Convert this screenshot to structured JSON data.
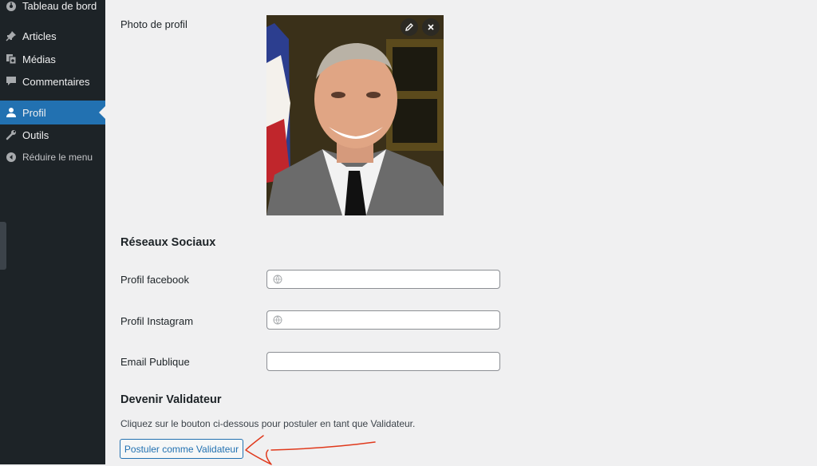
{
  "sidebar": {
    "items": [
      {
        "label": "Tableau de bord",
        "icon": "dashboard-icon"
      },
      {
        "label": "Articles",
        "icon": "pin-icon"
      },
      {
        "label": "Médias",
        "icon": "media-icon"
      },
      {
        "label": "Commentaires",
        "icon": "comment-icon"
      },
      {
        "label": "Profil",
        "icon": "user-icon",
        "active": true
      },
      {
        "label": "Outils",
        "icon": "wrench-icon"
      },
      {
        "label": "Réduire le menu",
        "icon": "collapse-icon"
      }
    ]
  },
  "profile_photo": {
    "label": "Photo de profil",
    "edit_icon": "pencil-icon",
    "remove_icon": "close-icon"
  },
  "social": {
    "title": "Réseaux Sociaux",
    "facebook_label": "Profil facebook",
    "facebook_value": "",
    "instagram_label": "Profil Instagram",
    "instagram_value": "",
    "email_label": "Email Publique",
    "email_value": ""
  },
  "validator": {
    "title": "Devenir Validateur",
    "description": "Cliquez sur le bouton ci-dessous pour postuler en tant que Validateur.",
    "button_label": "Postuler comme Validateur"
  },
  "colors": {
    "sidebar_bg": "#1d2327",
    "accent": "#2271b1",
    "page_bg": "#f0f0f1",
    "annotation": "#e0391c"
  }
}
